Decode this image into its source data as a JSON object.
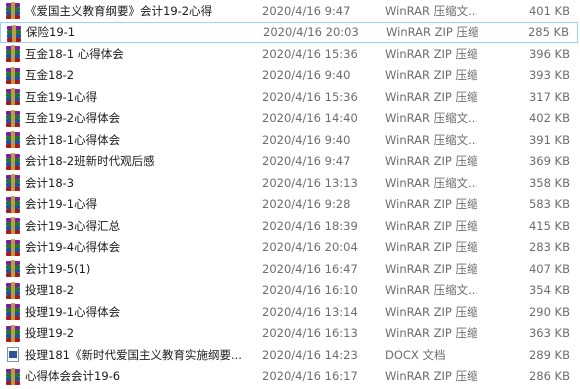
{
  "files": [
    {
      "name": "《爱国主义教育纲要》会计19-2心得",
      "date": "2020/4/16 9:47",
      "type": "WinRAR 压缩文...",
      "size": "401 KB",
      "icon": "winrar-archive-icon",
      "selected": false
    },
    {
      "name": "保险19-1",
      "date": "2020/4/16 20:03",
      "type": "WinRAR ZIP 压缩...",
      "size": "285 KB",
      "icon": "winrar-archive-icon",
      "selected": true
    },
    {
      "name": "互金18-1 心得体会",
      "date": "2020/4/16 15:36",
      "type": "WinRAR ZIP 压缩...",
      "size": "396 KB",
      "icon": "winrar-archive-icon",
      "selected": false
    },
    {
      "name": "互金18-2",
      "date": "2020/4/16 9:40",
      "type": "WinRAR ZIP 压缩...",
      "size": "393 KB",
      "icon": "winrar-archive-icon",
      "selected": false
    },
    {
      "name": "互金19-1心得",
      "date": "2020/4/16 15:36",
      "type": "WinRAR ZIP 压缩...",
      "size": "317 KB",
      "icon": "winrar-archive-icon",
      "selected": false
    },
    {
      "name": "互金19-2心得体会",
      "date": "2020/4/16 14:40",
      "type": "WinRAR 压缩文...",
      "size": "402 KB",
      "icon": "winrar-archive-icon",
      "selected": false
    },
    {
      "name": "会计18-1心得体会",
      "date": "2020/4/16 9:40",
      "type": "WinRAR 压缩文...",
      "size": "391 KB",
      "icon": "winrar-archive-icon",
      "selected": false
    },
    {
      "name": "会计18-2班新时代观后感",
      "date": "2020/4/16 9:47",
      "type": "WinRAR ZIP 压缩...",
      "size": "369 KB",
      "icon": "winrar-archive-icon",
      "selected": false
    },
    {
      "name": "会计18-3",
      "date": "2020/4/16 13:13",
      "type": "WinRAR 压缩文...",
      "size": "358 KB",
      "icon": "winrar-archive-icon",
      "selected": false
    },
    {
      "name": "会计19-1心得",
      "date": "2020/4/16 9:28",
      "type": "WinRAR ZIP 压缩...",
      "size": "583 KB",
      "icon": "winrar-archive-icon",
      "selected": false
    },
    {
      "name": "会计19-3心得汇总",
      "date": "2020/4/16 18:39",
      "type": "WinRAR ZIP 压缩...",
      "size": "415 KB",
      "icon": "winrar-archive-icon",
      "selected": false
    },
    {
      "name": "会计19-4心得体会",
      "date": "2020/4/16 20:04",
      "type": "WinRAR ZIP 压缩...",
      "size": "283 KB",
      "icon": "winrar-archive-icon",
      "selected": false
    },
    {
      "name": "会计19-5(1)",
      "date": "2020/4/16 16:47",
      "type": "WinRAR ZIP 压缩...",
      "size": "407 KB",
      "icon": "winrar-archive-icon",
      "selected": false
    },
    {
      "name": "投理18-2",
      "date": "2020/4/16 16:10",
      "type": "WinRAR 压缩文...",
      "size": "354 KB",
      "icon": "winrar-archive-icon",
      "selected": false
    },
    {
      "name": "投理19-1心得体会",
      "date": "2020/4/16 13:14",
      "type": "WinRAR ZIP 压缩...",
      "size": "290 KB",
      "icon": "winrar-archive-icon",
      "selected": false
    },
    {
      "name": "投理19-2",
      "date": "2020/4/16 16:13",
      "type": "WinRAR ZIP 压缩...",
      "size": "363 KB",
      "icon": "winrar-archive-icon",
      "selected": false
    },
    {
      "name": "投理181《新时代爱国主义教育实施纲要...",
      "date": "2020/4/16 14:23",
      "type": "DOCX 文档",
      "size": "289 KB",
      "icon": "docx-document-icon",
      "selected": false
    },
    {
      "name": "心得体会会计19-6",
      "date": "2020/4/16 16:17",
      "type": "WinRAR ZIP 压缩...",
      "size": "286 KB",
      "icon": "winrar-archive-icon",
      "selected": false
    }
  ],
  "colors": {
    "selection_border": "#99d1ff",
    "secondary_text": "#6d6d6d",
    "primary_text": "#1a1a1a"
  }
}
